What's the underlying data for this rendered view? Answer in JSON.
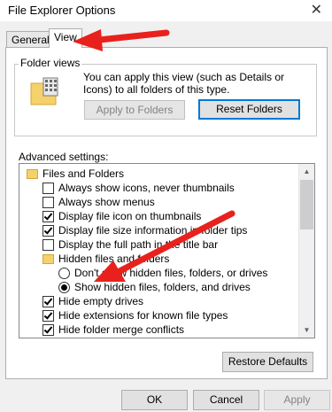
{
  "window": {
    "title": "File Explorer Options"
  },
  "tabs": [
    {
      "label": "General"
    },
    {
      "label": "View"
    }
  ],
  "folder_views": {
    "label": "Folder views",
    "description": "You can apply this view (such as Details or Icons) to all folders of this type.",
    "apply_button": "Apply to Folders",
    "reset_button": "Reset Folders"
  },
  "advanced": {
    "label": "Advanced settings:",
    "items": [
      {
        "type": "folder",
        "label": "Files and Folders"
      },
      {
        "type": "checkbox",
        "label": "Always show icons, never thumbnails",
        "checked": false
      },
      {
        "type": "checkbox",
        "label": "Always show menus",
        "checked": false
      },
      {
        "type": "checkbox",
        "label": "Display file icon on thumbnails",
        "checked": true
      },
      {
        "type": "checkbox",
        "label": "Display file size information in folder tips",
        "checked": true
      },
      {
        "type": "checkbox",
        "label": "Display the full path in the title bar",
        "checked": false
      },
      {
        "type": "folder",
        "label": "Hidden files and folders"
      },
      {
        "type": "radio",
        "label": "Don't show hidden files, folders, or drives",
        "checked": false
      },
      {
        "type": "radio",
        "label": "Show hidden files, folders, and drives",
        "checked": true
      },
      {
        "type": "checkbox",
        "label": "Hide empty drives",
        "checked": true
      },
      {
        "type": "checkbox",
        "label": "Hide extensions for known file types",
        "checked": true
      },
      {
        "type": "checkbox",
        "label": "Hide folder merge conflicts",
        "checked": true
      }
    ]
  },
  "restore_defaults_button": "Restore Defaults",
  "dialog_buttons": {
    "ok": "OK",
    "cancel": "Cancel",
    "apply": "Apply"
  },
  "icons": {
    "close": "close-icon",
    "folder": "folder-icon",
    "scroll_up": "scroll-up-icon",
    "scroll_down": "scroll-down-icon"
  },
  "colors": {
    "annotation_arrow": "#e8211d",
    "focus_border": "#0078d7",
    "folder_yellow": "#f4d16b"
  }
}
